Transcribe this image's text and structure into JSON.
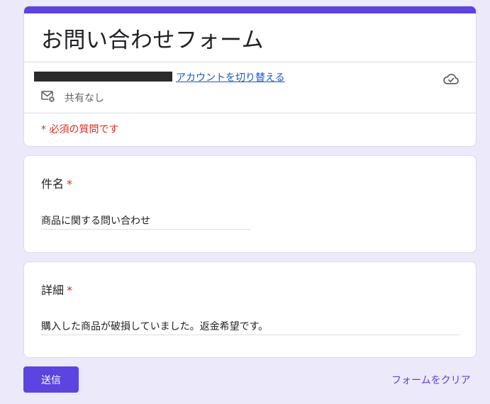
{
  "colors": {
    "accent": "#5b44e0",
    "background": "#ece9fb",
    "required": "#d93025",
    "link": "#1a56c9"
  },
  "header": {
    "title": "お問い合わせフォーム",
    "switch_account_label": "アカウントを切り替える",
    "sharing_status": "共有なし",
    "required_note": "* 必須の質問です",
    "cloud_icon": "cloud-check-icon",
    "mail_icon": "mail-not-shared-icon"
  },
  "questions": [
    {
      "label": "件名",
      "required_mark": "*",
      "answer": "商品に関する問い合わせ"
    },
    {
      "label": "詳細",
      "required_mark": "*",
      "answer": "購入した商品が破損していました。返金希望です。"
    }
  ],
  "actions": {
    "submit_label": "送信",
    "clear_label": "フォームをクリア"
  }
}
